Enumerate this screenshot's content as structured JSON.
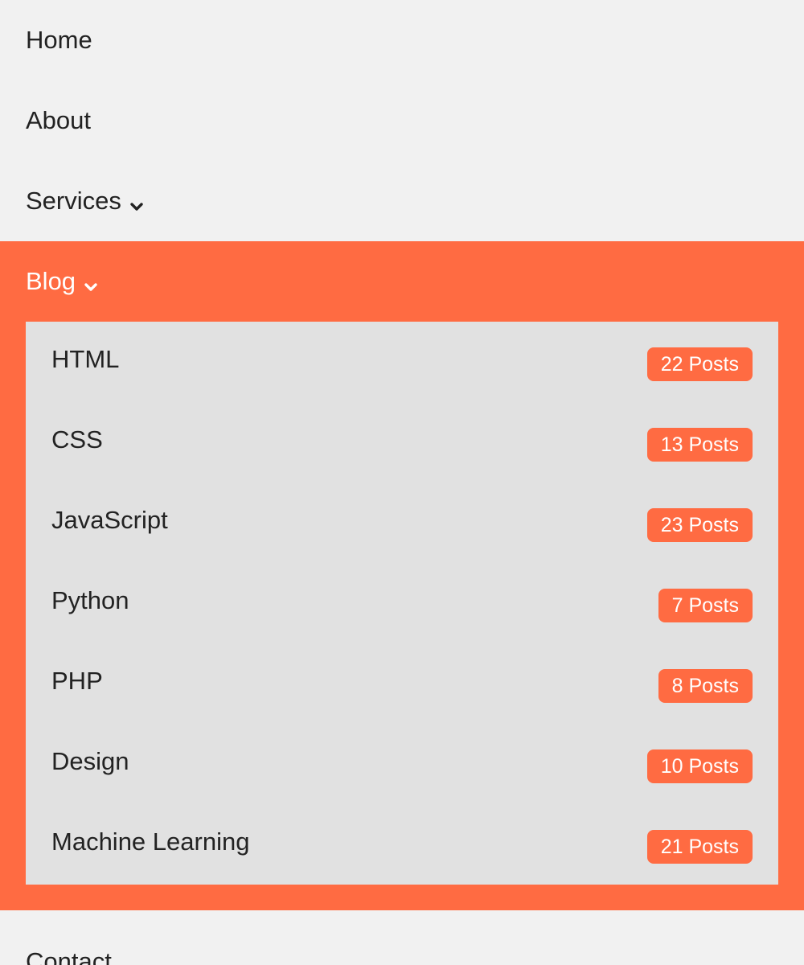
{
  "nav": {
    "home": "Home",
    "about": "About",
    "services": "Services",
    "blog": "Blog",
    "contact": "Contact"
  },
  "blog_submenu": [
    {
      "label": "HTML",
      "count": "22 Posts"
    },
    {
      "label": "CSS",
      "count": "13 Posts"
    },
    {
      "label": "JavaScript",
      "count": "23 Posts"
    },
    {
      "label": "Python",
      "count": "7 Posts"
    },
    {
      "label": "PHP",
      "count": "8 Posts"
    },
    {
      "label": "Design",
      "count": "10 Posts"
    },
    {
      "label": "Machine Learning",
      "count": "21 Posts"
    }
  ],
  "icons": {
    "dropdown": "chevron-down-icon"
  },
  "colors": {
    "accent": "#ff6b42",
    "background": "#f1f1f1",
    "submenu_background": "#e1e1e1",
    "text": "#222222"
  }
}
